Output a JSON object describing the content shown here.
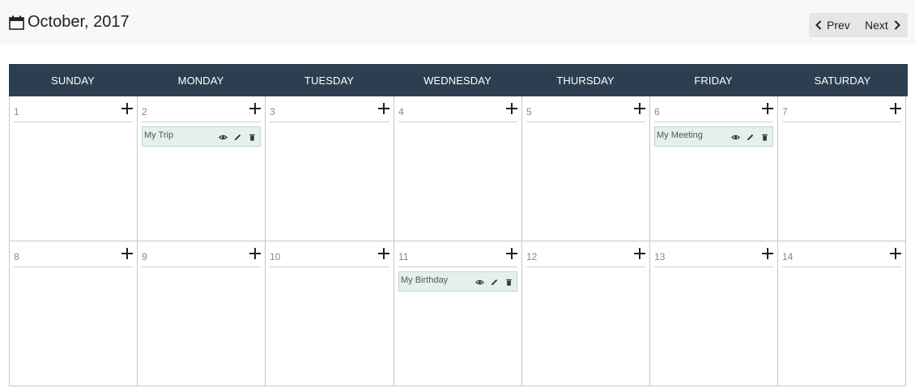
{
  "header": {
    "month_title": "October, 2017",
    "prev_label": "Prev",
    "next_label": "Next"
  },
  "weekdays": [
    "SUNDAY",
    "MONDAY",
    "TUESDAY",
    "WEDNESDAY",
    "THURSDAY",
    "FRIDAY",
    "SATURDAY"
  ],
  "weeks": [
    [
      "1",
      "2",
      "3",
      "4",
      "5",
      "6",
      "7"
    ],
    [
      "8",
      "9",
      "10",
      "11",
      "12",
      "13",
      "14"
    ]
  ],
  "events": {
    "trip": "My Trip",
    "meeting": "My Meeting",
    "birthday": "My Birthday"
  },
  "colors": {
    "header_bg": "#2d3e50",
    "event_bg": "#e3f0ee",
    "event_border": "#bcd8d3"
  },
  "icons": [
    "calendar-icon",
    "chevron-left-icon",
    "chevron-right-icon",
    "plus-icon",
    "eye-icon",
    "pencil-icon",
    "trash-icon"
  ]
}
